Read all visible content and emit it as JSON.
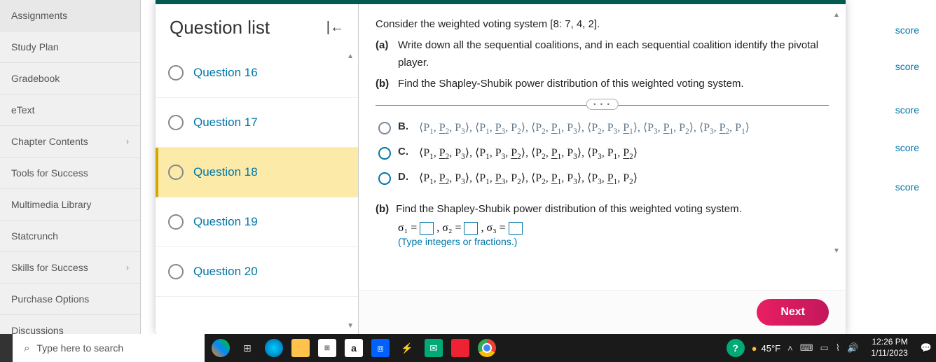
{
  "sidebar": {
    "items": [
      {
        "label": "Assignments",
        "chevron": false
      },
      {
        "label": "Study Plan",
        "chevron": false
      },
      {
        "label": "Gradebook",
        "chevron": false
      },
      {
        "label": "eText",
        "chevron": false
      },
      {
        "label": "Chapter Contents",
        "chevron": true
      },
      {
        "label": "Tools for Success",
        "chevron": false
      },
      {
        "label": "Multimedia Library",
        "chevron": false
      },
      {
        "label": "Statcrunch",
        "chevron": false
      },
      {
        "label": "Skills for Success",
        "chevron": true
      },
      {
        "label": "Purchase Options",
        "chevron": false
      },
      {
        "label": "Discussions",
        "chevron": false
      }
    ]
  },
  "scoreLabel": "score",
  "questionList": {
    "title": "Question list",
    "items": [
      {
        "label": "Question 16",
        "selected": false
      },
      {
        "label": "Question 17",
        "selected": false
      },
      {
        "label": "Question 18",
        "selected": true
      },
      {
        "label": "Question 19",
        "selected": false
      },
      {
        "label": "Question 20",
        "selected": false
      }
    ]
  },
  "question": {
    "intro": "Consider the weighted voting system [8: 7, 4, 2].",
    "partA_label": "(a)",
    "partA_text": "Write down all the sequential coalitions, and in each sequential coalition identify the pivotal player.",
    "partB_label": "(b)",
    "partB_text": "Find the Shapley-Shubik power distribution of this weighted voting system.",
    "choices": {
      "B": "⟨P₁, P₂, P₃⟩, ⟨P₁, P₃, P₂⟩, ⟨P₂, P₁, P₃⟩, ⟨P₂, P₃, P₁⟩, ⟨P₃, P₁, P₂⟩, ⟨P₃, P₂, P₁⟩",
      "C": "⟨P₁, P₂, P₃⟩, ⟨P₁, P₃, P₂⟩, ⟨P₂, P₁, P₃⟩, ⟨P₃, P₁, P₂⟩",
      "D": "⟨P₁, P₂, P₃⟩, ⟨P₁, P₃, P₂⟩, ⟨P₂, P₁, P₃⟩, ⟨P₃, P₁, P₂⟩"
    },
    "partB2_label": "(b)",
    "partB2_text": "Find the Shapley-Shubik power distribution of this weighted voting system.",
    "sigma1": "σ₁ =",
    "sigma2": ", σ₂ =",
    "sigma3": ", σ₃ =",
    "hint": "(Type integers or fractions.)"
  },
  "nextLabel": "Next",
  "taskbar": {
    "searchPlaceholder": "Type here to search",
    "weather": "45°F",
    "time": "12:26 PM",
    "date": "1/11/2023"
  }
}
